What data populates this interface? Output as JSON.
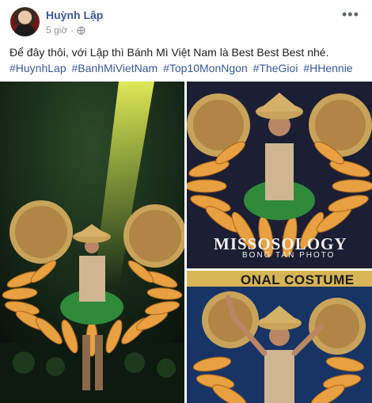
{
  "post": {
    "author": "Huỳnh Lập",
    "time": "5 giờ",
    "privacy_icon": "globe-icon",
    "more_icon": "more-options-icon",
    "text": "Để đây thôi, với Lập thì Bánh Mì Việt Nam là Best Best Best nhé.",
    "hashtags": [
      "#HuynhLap",
      "#BanhMiVietNam",
      "#Top10MonNgon",
      "#TheGioi",
      "#HHennie"
    ]
  },
  "photos": {
    "watermark_title": "MISSOSOLOGY",
    "watermark_sub": "BONG TAN PHOTO",
    "banner_text": "ONAL COSTUME"
  },
  "colors": {
    "link": "#385898",
    "meta": "#90949c",
    "bread": "#e8a040",
    "hat": "#c9a35a"
  }
}
